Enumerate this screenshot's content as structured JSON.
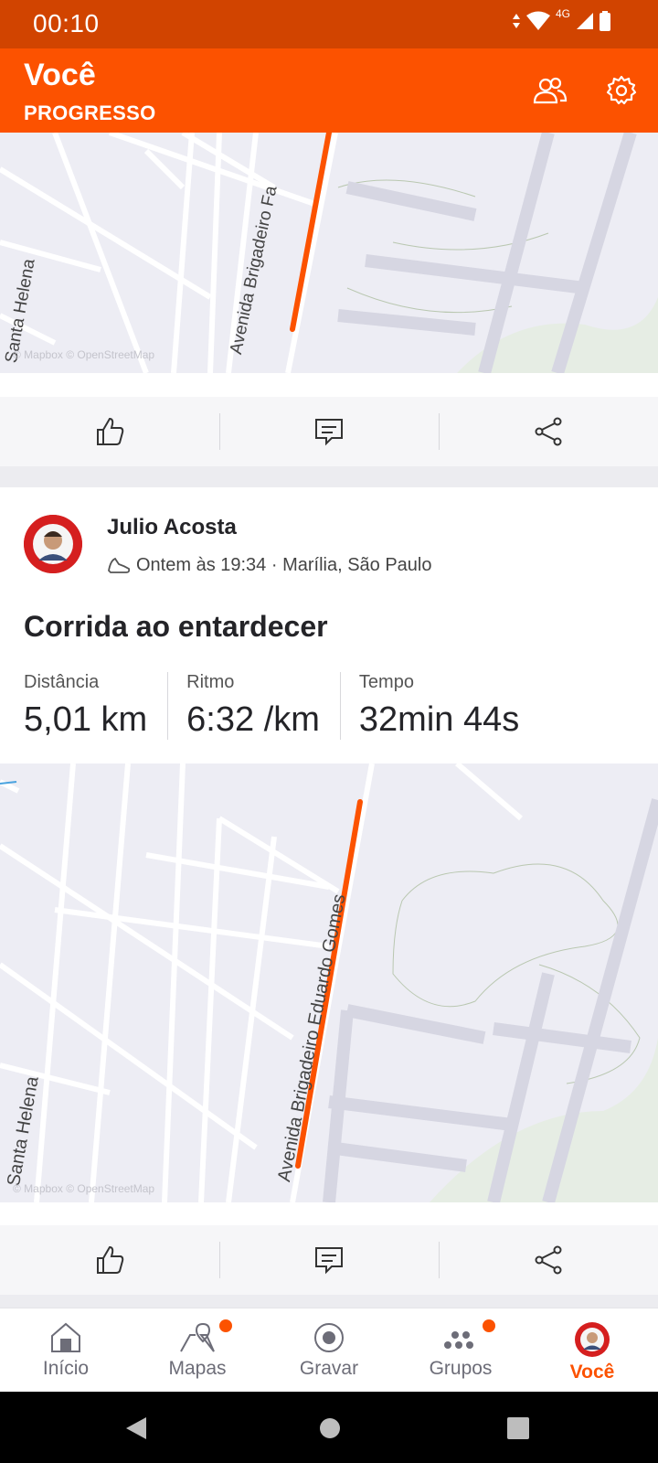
{
  "status_bar": {
    "time": "00:10",
    "network": "4G"
  },
  "header": {
    "title": "Você",
    "subtitle": "PROGRESSO"
  },
  "map_top": {
    "street": "Avenida Brigadeiro Fa",
    "side_street": "Santa Helena",
    "attribution": "© Mapbox © OpenStreetMap"
  },
  "activity": {
    "athlete": "Julio Acosta",
    "meta": "Ontem às 19:34 · Marília, São Paulo",
    "title": "Corrida ao entardecer",
    "stats": [
      {
        "label": "Distância",
        "value": "5,01 km"
      },
      {
        "label": "Ritmo",
        "value": "6:32 /km"
      },
      {
        "label": "Tempo",
        "value": "32min 44s"
      }
    ],
    "map": {
      "street": "Avenida Brigadeiro Eduardo Gomes",
      "side_street": "Santa Helena",
      "attribution": "© Mapbox © OpenStreetMap"
    }
  },
  "nav": [
    {
      "label": "Início",
      "icon": "home-icon"
    },
    {
      "label": "Mapas",
      "icon": "map-icon"
    },
    {
      "label": "Gravar",
      "icon": "record-icon"
    },
    {
      "label": "Grupos",
      "icon": "groups-icon"
    },
    {
      "label": "Você",
      "icon": "avatar-icon"
    }
  ],
  "colors": {
    "brand": "#fc5200",
    "status_bar": "#d14400",
    "route": "#fc5200"
  }
}
